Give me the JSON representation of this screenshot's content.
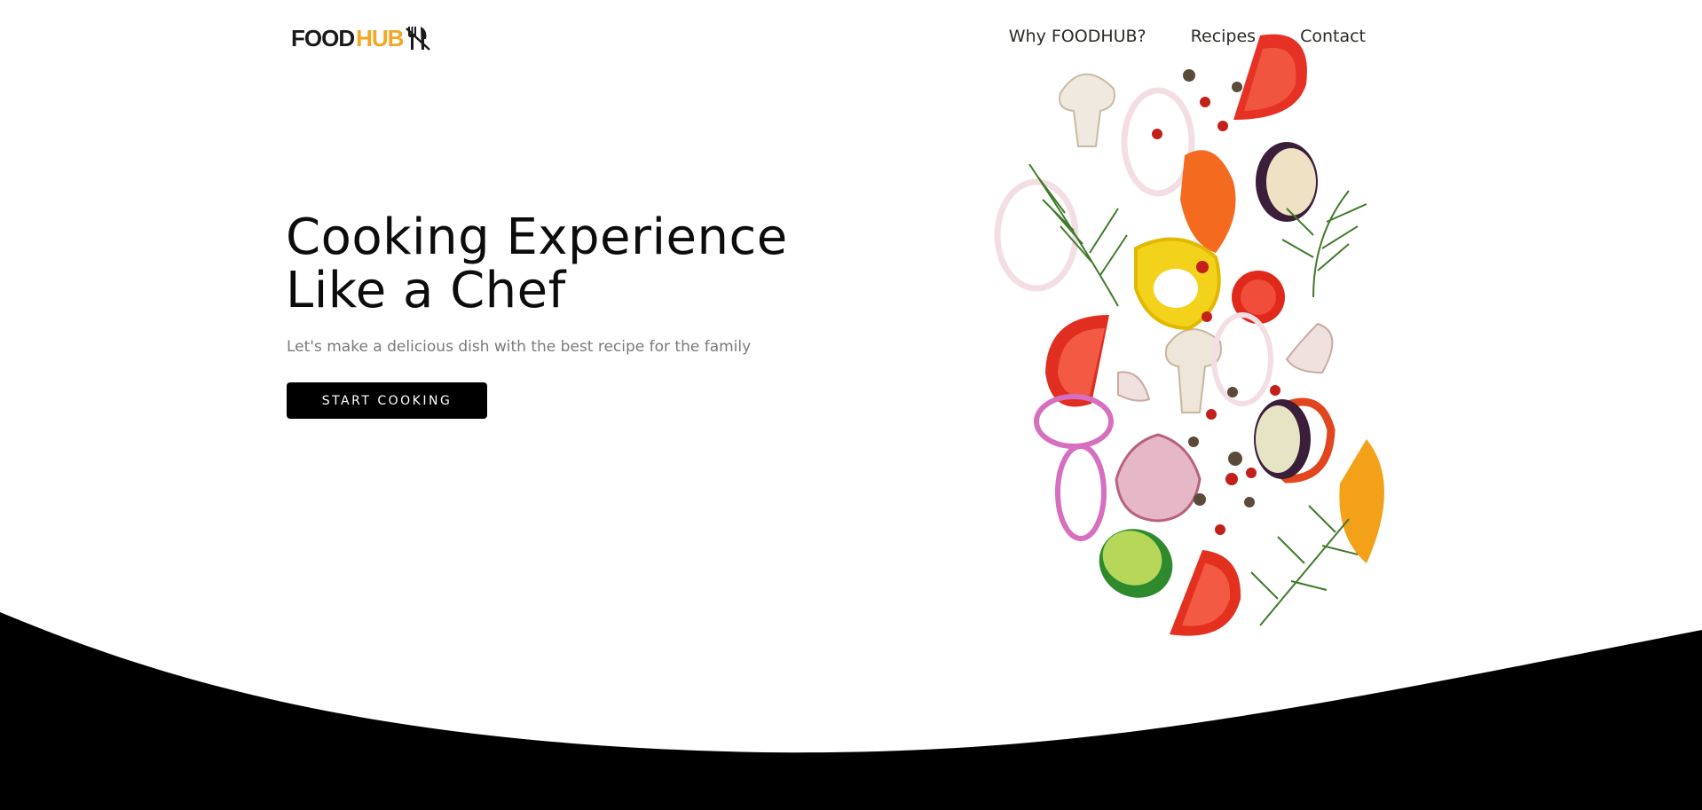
{
  "brand": {
    "part1": "FOOD",
    "part2": "HUB",
    "accent_color": "#f5a623",
    "icon": "fork-knife-icon"
  },
  "nav": {
    "items": [
      {
        "label": "Why FOODHUB?"
      },
      {
        "label": "Recipes"
      },
      {
        "label": "Contact"
      }
    ]
  },
  "hero": {
    "title_line1": "Cooking Experience",
    "title_line2": "Like a Chef",
    "subtitle": "Let's make a delicious dish with the best recipe for the family",
    "cta_label": "START COOKING"
  },
  "colors": {
    "background": "#ffffff",
    "text": "#0c0c0c",
    "button": "#000000",
    "wave": "#000000"
  },
  "illustration": "falling-vegetables-illustration"
}
